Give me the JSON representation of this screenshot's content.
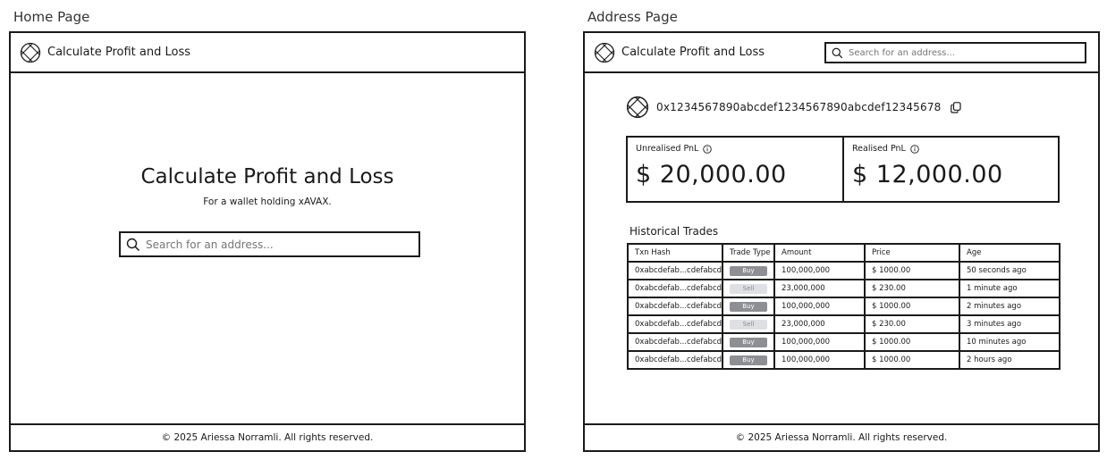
{
  "home": {
    "page_label": "Home Page",
    "brand": "Calculate Profit and Loss",
    "hero_title": "Calculate Profit and Loss",
    "hero_subtitle": "For a wallet holding xAVAX.",
    "search_placeholder": "Search for an address...",
    "footer": "© 2025 Ariessa Norramli. All rights reserved."
  },
  "address": {
    "page_label": "Address Page",
    "brand": "Calculate Profit and Loss",
    "search_placeholder": "Search for an address...",
    "wallet_address": "0x1234567890abcdef1234567890abcdef12345678",
    "unrealised": {
      "label": "Unrealised PnL",
      "value": "$ 20,000.00"
    },
    "realised": {
      "label": "Realised PnL",
      "value": "$ 12,000.00"
    },
    "historical_title": "Historical Trades",
    "table": {
      "headers": [
        "Txn Hash",
        "Trade Type",
        "Amount",
        "Price",
        "Age"
      ],
      "rows": [
        {
          "hash": "0xabcdefab...cdefabcd",
          "type": "Buy",
          "amount": "100,000,000",
          "price": "$ 1000.00",
          "age": "50 seconds ago"
        },
        {
          "hash": "0xabcdefab...cdefabcd",
          "type": "Sell",
          "amount": "23,000,000",
          "price": "$ 230.00",
          "age": "1 minute ago"
        },
        {
          "hash": "0xabcdefab...cdefabcd",
          "type": "Buy",
          "amount": "100,000,000",
          "price": "$ 1000.00",
          "age": "2 minutes ago"
        },
        {
          "hash": "0xabcdefab...cdefabcd",
          "type": "Sell",
          "amount": "23,000,000",
          "price": "$ 230.00",
          "age": "3 minutes ago"
        },
        {
          "hash": "0xabcdefab...cdefabcd",
          "type": "Buy",
          "amount": "100,000,000",
          "price": "$ 1000.00",
          "age": "10 minutes ago"
        },
        {
          "hash": "0xabcdefab...cdefabcd",
          "type": "Buy",
          "amount": "100,000,000",
          "price": "$ 1000.00",
          "age": "2 hours ago"
        }
      ]
    },
    "footer": "© 2025 Ariessa Norramli. All rights reserved."
  },
  "icons": {
    "logo": "globe-grid-logo-icon",
    "search": "search-icon",
    "copy": "copy-icon",
    "info": "info-icon"
  },
  "colors": {
    "border": "#1a1a1a",
    "buy_badge": "#8e8f94",
    "sell_badge": "#dfe0e3"
  }
}
